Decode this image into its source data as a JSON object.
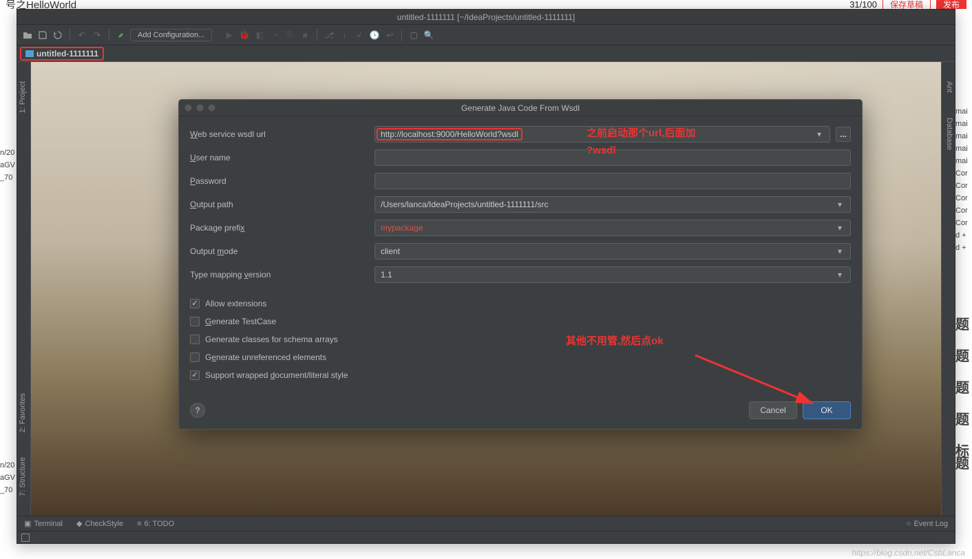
{
  "outer": {
    "title_fragment": "号之HelloWorld",
    "counter": "31/100",
    "draft_btn": "保存草稿",
    "publish_btn": "发布"
  },
  "ide": {
    "window_title": "untitled-1111111 [~/IdeaProjects/untitled-1111111]",
    "config_btn": "Add Configuration...",
    "breadcrumb": "untitled-1111111",
    "left_tabs": {
      "project": "1: Project",
      "favorites": "2: Favorites",
      "structure": "7: Structure"
    },
    "right_tabs": {
      "ant": "Ant",
      "database": "Database"
    },
    "status": {
      "terminal": "Terminal",
      "checkstyle": "CheckStyle",
      "todo": "6: TODO",
      "eventlog": "Event Log"
    }
  },
  "dialog": {
    "title": "Generate Java Code From Wsdl",
    "labels": {
      "wsdl_url": "Web service wsdl url",
      "user_name": "User name",
      "password": "Password",
      "output_path": "Output path",
      "package_prefix": "Package prefix",
      "output_mode": "Output mode",
      "type_mapping": "Type mapping version"
    },
    "values": {
      "wsdl_url": "http://localhost:9000/HelloWorld?wsdl",
      "user_name": "",
      "password": "",
      "output_path": "/Users/lanca/IdeaProjects/untitled-1111111/src",
      "package_prefix": "mypackage",
      "output_mode": "client",
      "type_mapping": "1.1"
    },
    "checks": {
      "allow_ext": "Allow extensions",
      "gen_testcase": "Generate TestCase",
      "gen_schema": "Generate classes for schema arrays",
      "gen_unref": "Generate unreferenced elements",
      "wrapped": "Support wrapped document/literal style"
    },
    "buttons": {
      "cancel": "Cancel",
      "ok": "OK",
      "help": "?",
      "browse": "..."
    }
  },
  "annotations": {
    "url_note_1": "之前启动那个url,后面加",
    "url_note_2": "?wsdl",
    "ok_note": "其他不用管,然后点ok"
  },
  "behind_left": [
    "n/20",
    "aGV",
    "_70"
  ],
  "behind_right_top": [
    "mai",
    "mai",
    "mai",
    "mai",
    "mai",
    "Cor",
    "Cor",
    "Cor",
    "Cor",
    "Cor",
    "d +",
    "d +"
  ],
  "behind_right_big": [
    "题",
    "题",
    "题",
    "题",
    "标题"
  ],
  "watermark": "https://blog.csdn.net/CsbLanca"
}
